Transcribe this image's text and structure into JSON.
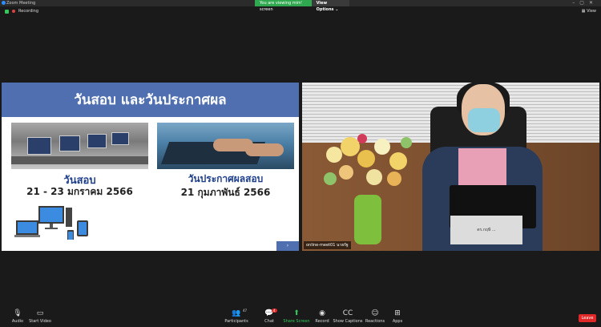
{
  "window": {
    "title": "Zoom Meeting"
  },
  "share_banner": {
    "status": "You are viewing mim' screen",
    "view_options": "View Options ⌄"
  },
  "recording": {
    "label": "Recording"
  },
  "view": {
    "label": "View"
  },
  "slide": {
    "title": "วันสอบ และวันประกาศผล",
    "exam_label": "วันสอบ",
    "exam_date": "21 - 23 มกราคม  2566",
    "result_label": "วันประกาศผลสอบ",
    "result_date": "21 กุมภาพันธ์  2566",
    "page_marker": "›"
  },
  "video": {
    "placard": "ดร.กฤษี ...",
    "participant_name": "online-meet01 นายรัฐ"
  },
  "toolbar": {
    "audio": "Audio",
    "start_video": "Start Video",
    "participants": "Participants",
    "participants_count": "47",
    "chat": "Chat",
    "chat_badge": "4",
    "share_screen": "Share Screen",
    "record": "Record",
    "show_captions": "Show Captions",
    "reactions": "Reactions",
    "apps": "Apps",
    "leave": "Leave"
  }
}
